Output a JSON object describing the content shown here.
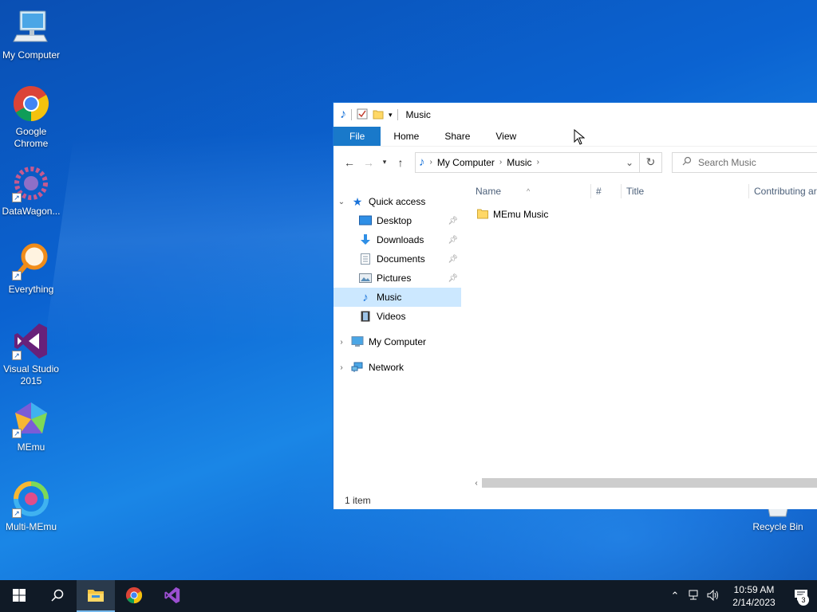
{
  "desktop": {
    "icons": [
      {
        "label": "My Computer"
      },
      {
        "label": "Google Chrome"
      },
      {
        "label": "DataWagon..."
      },
      {
        "label": "Everything"
      },
      {
        "label": "Visual Studio 2015"
      },
      {
        "label": "MEmu"
      },
      {
        "label": "Multi-MEmu"
      },
      {
        "label": "Recycle Bin"
      }
    ]
  },
  "explorer": {
    "title": "Music",
    "ribbon_tabs": [
      "File",
      "Home",
      "Share",
      "View"
    ],
    "address": {
      "crumbs": [
        "My Computer",
        "Music"
      ]
    },
    "search": {
      "placeholder": "Search Music"
    },
    "nav": {
      "quick_access": "Quick access",
      "items": [
        "Desktop",
        "Downloads",
        "Documents",
        "Pictures",
        "Music",
        "Videos"
      ],
      "selected": "Music",
      "my_computer": "My Computer",
      "network": "Network"
    },
    "columns": [
      "Name",
      "#",
      "Title",
      "Contributing ar"
    ],
    "files": [
      {
        "name": "MEmu Music",
        "icon": "folder-icon"
      }
    ],
    "status": "1 item"
  },
  "taskbar": {
    "time": "10:59 AM",
    "date": "2/14/2023",
    "notification_count": "3"
  },
  "colors": {
    "file_tab": "#1979ca",
    "selection": "#cce8ff",
    "taskbar": "#101a26"
  }
}
